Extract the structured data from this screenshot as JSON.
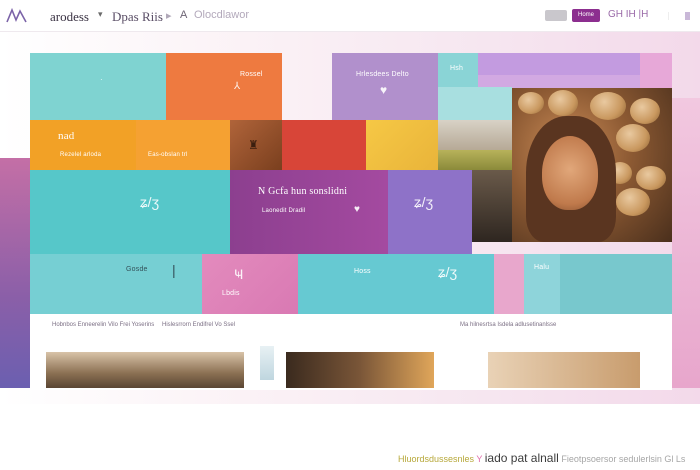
{
  "topbar": {
    "brand": "arodess",
    "section": "Dpas Riis",
    "crumb": "A",
    "sub": "Olocdlawor",
    "primary_button": "Home",
    "extra": "GH IH |H"
  },
  "hero": {
    "tile_nad": "nad",
    "tile_nad_caption": "Rezelel arloda",
    "tile_nad_caption2": "Eas-obslan trl",
    "tile_orange_top": "Rossel",
    "tile_purple_top": "Hrlesdees Delto",
    "tile_teal_small": "Hsh",
    "tile_center_title": "N Gcfa hun sonslidni",
    "tile_center_sub": "Laonedit Dradil",
    "tile_bottom_left": "Gosde",
    "tile_bottom_pink": "Halu",
    "tile_bottom_teal": "Hoss",
    "tile_bottom_pink_sub": "Lbdis"
  },
  "strip": {
    "caption_left": "Hobnbos Enneerelin  Vilo Frei Yoserins",
    "caption_mid": "Hislesrrorn Endifrel Vo  Ssel",
    "caption_right": "Ma hilnesrtsa Isdela adlusetinanlsse"
  },
  "footer": {
    "prefix": "Hluordsdussesnles",
    "mark": "Y",
    "emph": "iado pat alnall",
    "suffix": "Fieotpsoersor sedulerlsin",
    "tail": "Gl Ls"
  },
  "colors": {
    "accent": "#8c2e8f",
    "teal": "#6fc9cf",
    "orange": "#f0873f",
    "purple": "#a982c2"
  }
}
